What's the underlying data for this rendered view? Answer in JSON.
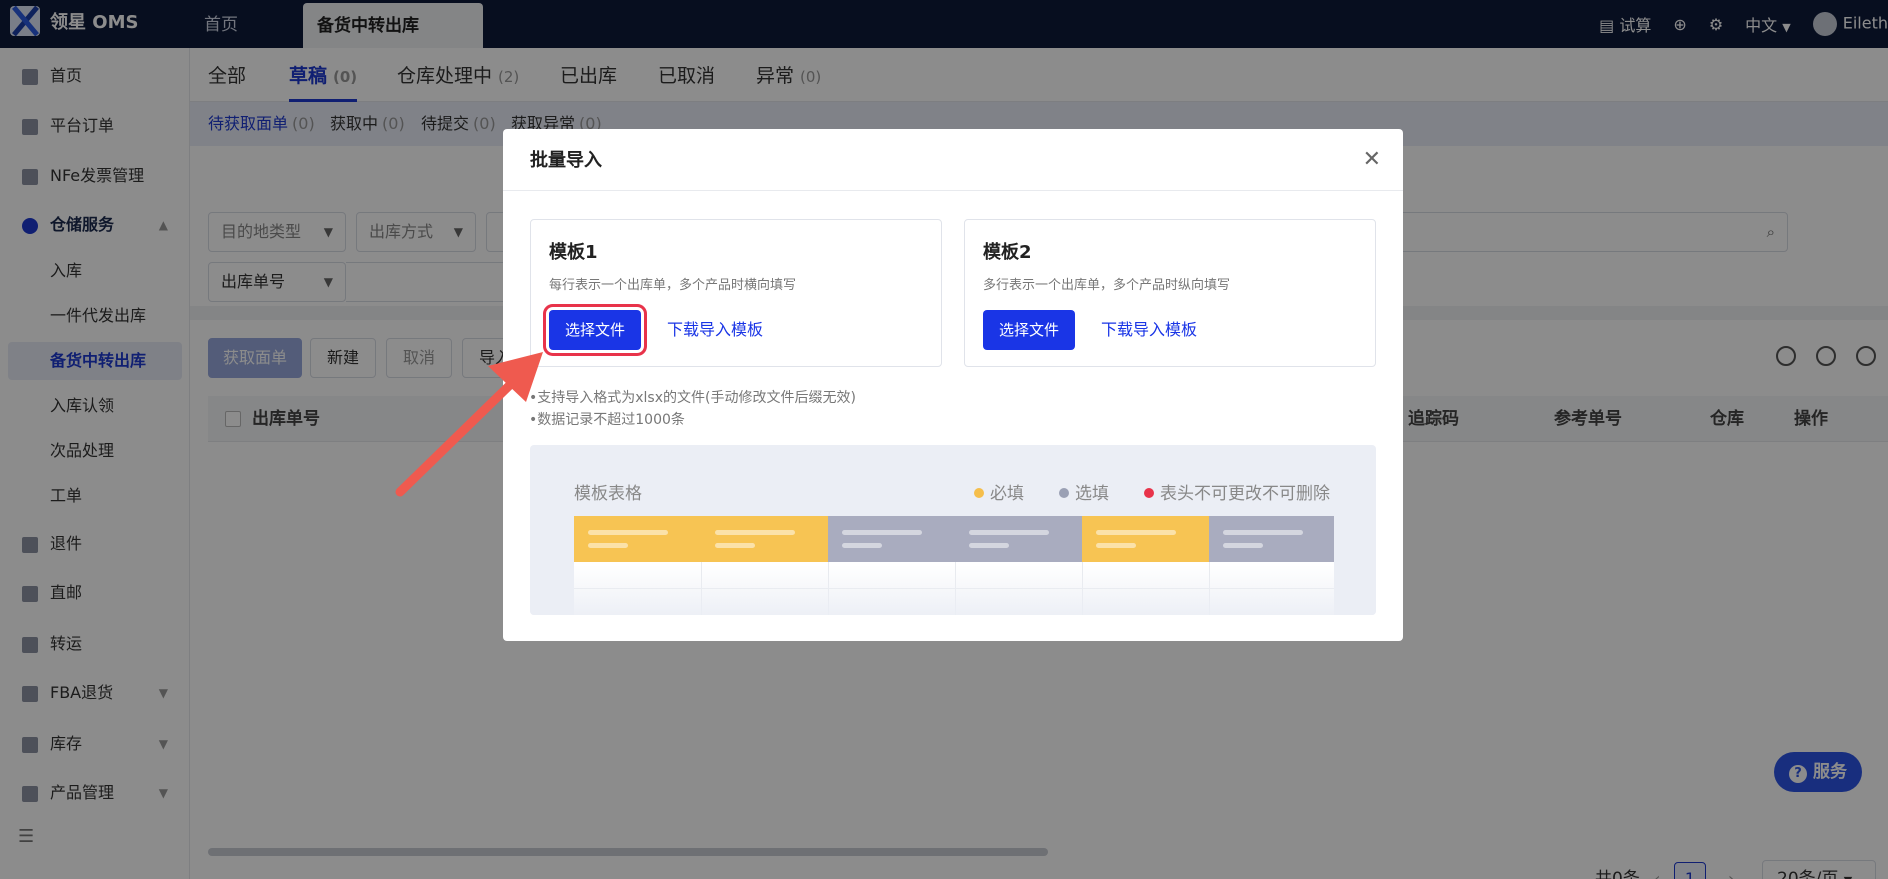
{
  "app": {
    "logo_text": "领星 OMS"
  },
  "top_tabs": {
    "home": "首页",
    "active": "备货中转出库"
  },
  "top_right": {
    "calc": "试算",
    "language": "中文",
    "user": "Eileth"
  },
  "sidebar": {
    "items": [
      {
        "label": "首页",
        "icon": "home-icon"
      },
      {
        "label": "平台订单",
        "icon": "clipboard-icon"
      },
      {
        "label": "NFe发票管理",
        "icon": "invoice-icon"
      },
      {
        "label": "仓储服务",
        "icon": "warehouse-icon"
      },
      {
        "label": "退件",
        "icon": "return-icon"
      },
      {
        "label": "直邮",
        "icon": "mail-icon"
      },
      {
        "label": "转运",
        "icon": "transfer-icon"
      },
      {
        "label": "FBA退货",
        "icon": "fba-icon"
      },
      {
        "label": "库存",
        "icon": "inventory-icon"
      },
      {
        "label": "产品管理",
        "icon": "product-icon"
      }
    ],
    "sub_items": [
      "入库",
      "一件代发出库",
      "备货中转出库",
      "入库认领",
      "次品处理",
      "工单"
    ]
  },
  "status_tabs": [
    {
      "label": "全部",
      "count": ""
    },
    {
      "label": "草稿",
      "count": "(0)"
    },
    {
      "label": "仓库处理中",
      "count": "(2)"
    },
    {
      "label": "已出库",
      "count": ""
    },
    {
      "label": "已取消",
      "count": ""
    },
    {
      "label": "异常",
      "count": "(0)"
    }
  ],
  "sub_status": [
    {
      "label": "待获取面单",
      "count": "(0)"
    },
    {
      "label": "获取中",
      "count": "(0)"
    },
    {
      "label": "待提交",
      "count": "(0)"
    },
    {
      "label": "获取异常",
      "count": "(0)"
    }
  ],
  "filters": {
    "dest_type": "目的地类型",
    "out_method": "出库方式",
    "order_no": "出库单号"
  },
  "toolbar": {
    "get_label": "获取面单",
    "new": "新建",
    "cancel": "取消",
    "import": "导入"
  },
  "table": {
    "columns": [
      "出库单号",
      "追踪码",
      "参考单号",
      "仓库",
      "操作"
    ]
  },
  "pager": {
    "total": "共0条",
    "page": "1",
    "size": "20条/页"
  },
  "service": {
    "label": "服务"
  },
  "modal": {
    "title": "批量导入",
    "templates": [
      {
        "name": "模板1",
        "desc": "每行表示一个出库单，多个产品时横向填写",
        "choose": "选择文件",
        "download": "下载导入模板"
      },
      {
        "name": "模板2",
        "desc": "多行表示一个出库单，多个产品时纵向填写",
        "choose": "选择文件",
        "download": "下载导入模板"
      }
    ],
    "notes": [
      "•支持导入格式为xlsx的文件(手动修改文件后缀无效)",
      "•数据记录不超过1000条"
    ],
    "preview": {
      "title": "模板表格",
      "legend": [
        {
          "label": "必填",
          "color": "#f5be4b"
        },
        {
          "label": "选填",
          "color": "#9aa0b4"
        },
        {
          "label": "表头不可更改不可删除",
          "color": "#e8334a"
        }
      ],
      "col_colors": [
        "#f7c453",
        "#f7c453",
        "#a9acbf",
        "#a9acbf",
        "#f7c453",
        "#a9acbf"
      ]
    }
  },
  "annotation_color": "#ef5a4f"
}
